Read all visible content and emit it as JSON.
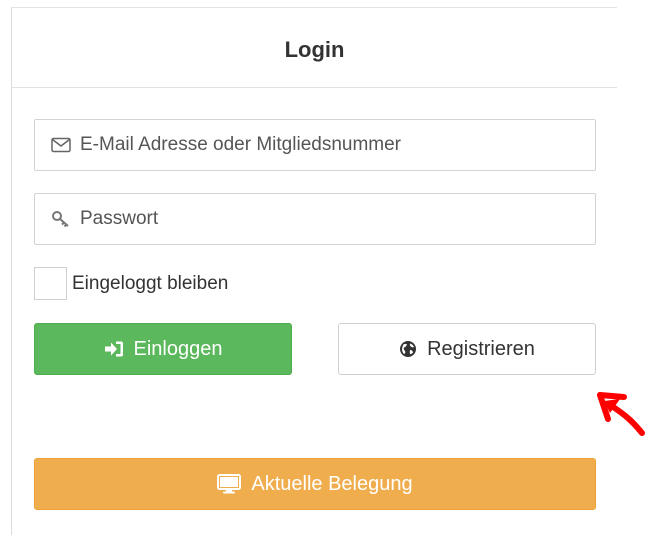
{
  "card": {
    "title": "Login"
  },
  "form": {
    "email_placeholder": "E-Mail Adresse oder Mitgliedsnummer",
    "email_icon": "envelope-icon",
    "password_placeholder": "Passwort",
    "password_icon": "key-icon",
    "remember_label": "Eingeloggt bleiben",
    "remember_checked": false
  },
  "buttons": {
    "login_label": "Einloggen",
    "login_icon": "sign-in-icon",
    "register_label": "Registrieren",
    "register_icon": "globe-icon",
    "occupancy_label": "Aktuelle Belegung",
    "occupancy_icon": "monitor-icon"
  },
  "colors": {
    "login": "#5cb85c",
    "occupancy": "#f0ad4e",
    "annotation": "#ff0000"
  }
}
